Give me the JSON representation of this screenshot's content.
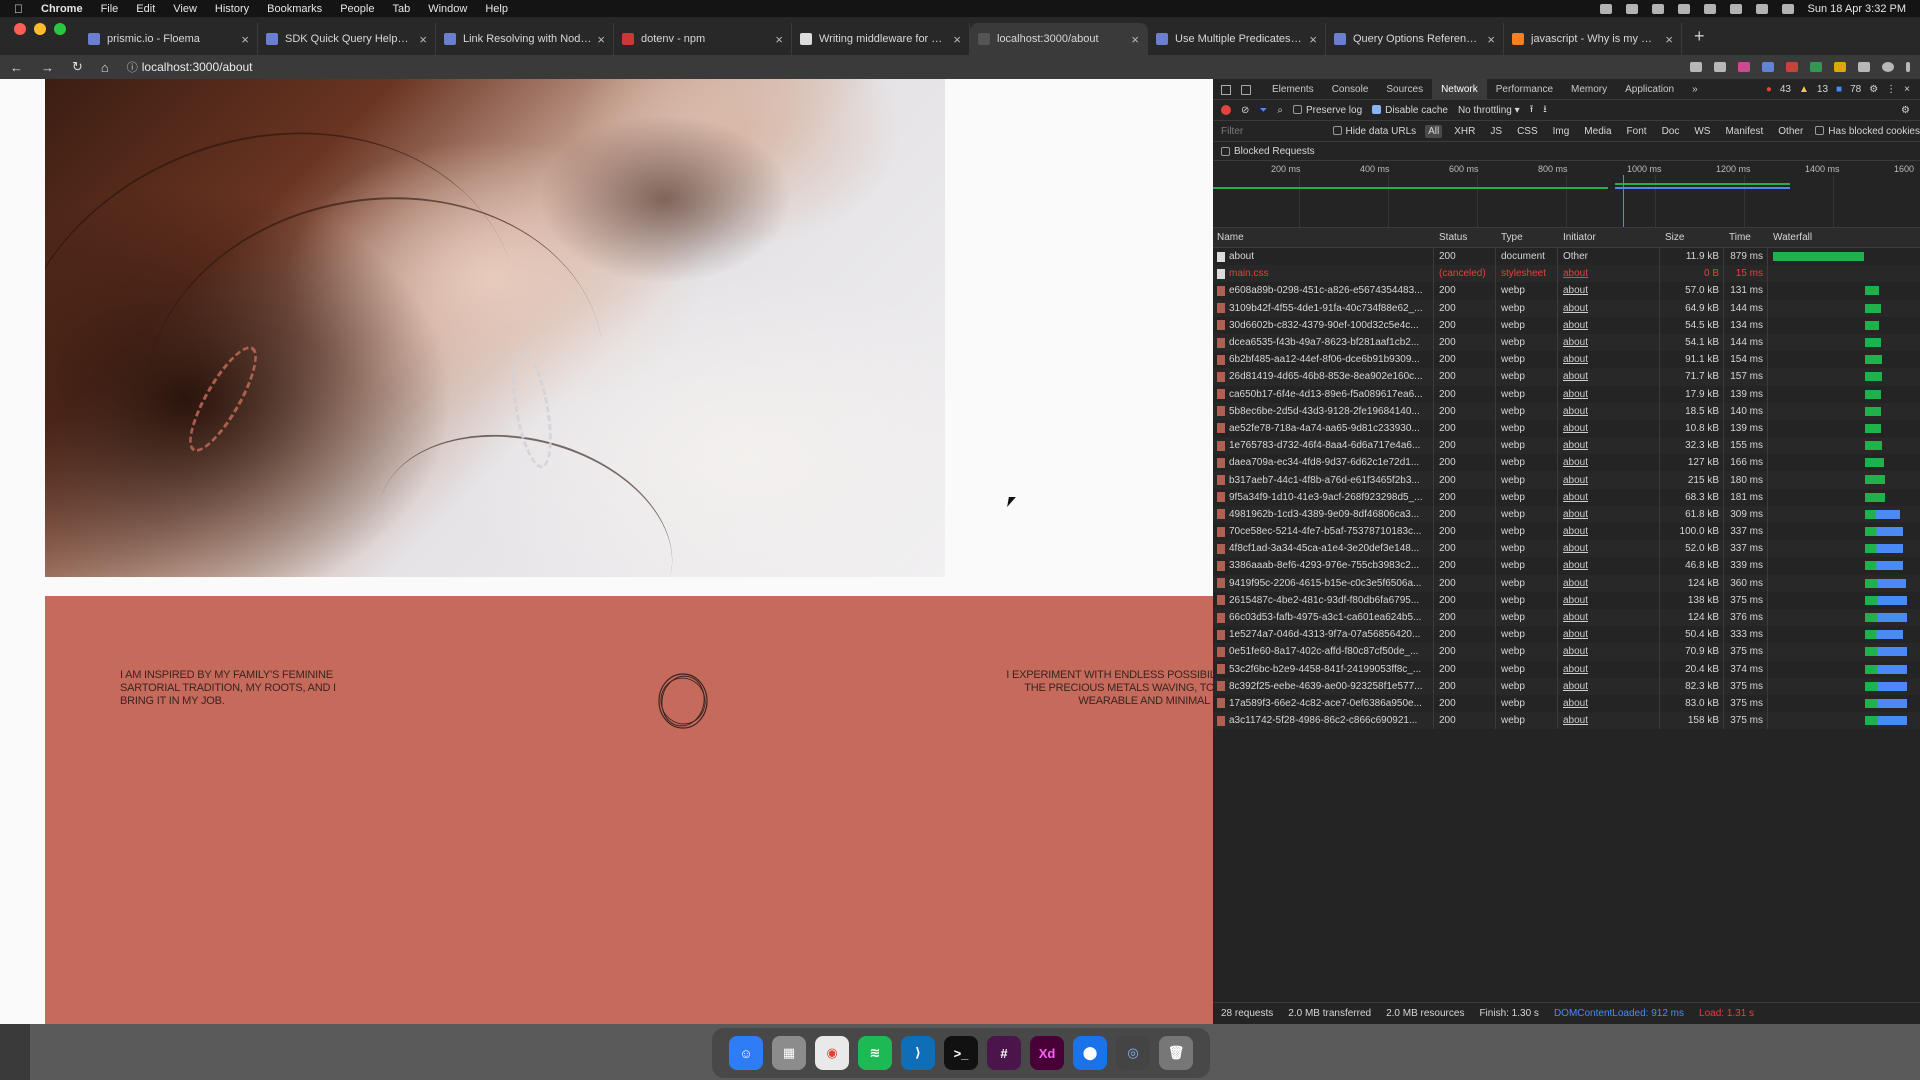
{
  "menubar": {
    "app": "Chrome",
    "items": [
      "File",
      "Edit",
      "View",
      "History",
      "Bookmarks",
      "People",
      "Tab",
      "Window",
      "Help"
    ],
    "clock": "Sun 18 Apr  3:32 PM"
  },
  "tabs": [
    {
      "title": "prismic.io - Floema"
    },
    {
      "title": "SDK Quick Query Helper functi..."
    },
    {
      "title": "Link Resolving with Node.js - P..."
    },
    {
      "title": "dotenv - npm"
    },
    {
      "title": "Writing middleware for use in E..."
    },
    {
      "title": "localhost:3000/about",
      "active": true
    },
    {
      "title": "Use Multiple Predicates in Java..."
    },
    {
      "title": "Query Options Reference in Ja..."
    },
    {
      "title": "javascript - Why is my middlew..."
    }
  ],
  "address": {
    "url": "localhost:3000/about"
  },
  "page": {
    "quote_left": "I AM INSPIRED BY MY FAMILY'S FEMININE SARTORIAL TRADITION, MY ROOTS, AND I BRING IT IN MY JOB.",
    "quote_right_1": "I EXPERIMENT WITH ENDLESS POSSIBILIT",
    "quote_right_2": "THE PRECIOUS METALS WAVING, TO C",
    "quote_right_3": "WEARABLE AND MINIMAL JE"
  },
  "devtools": {
    "panels": [
      "Elements",
      "Console",
      "Sources",
      "Network",
      "Performance",
      "Memory",
      "Application"
    ],
    "errors": "43",
    "warnings": "13",
    "messages": "78",
    "toolbar": {
      "preserve_log": "Preserve log",
      "disable_cache": "Disable cache",
      "throttling": "No throttling"
    },
    "filter": {
      "placeholder": "Filter",
      "hide_data_urls": "Hide data URLs",
      "types": [
        "All",
        "XHR",
        "JS",
        "CSS",
        "Img",
        "Media",
        "Font",
        "Doc",
        "WS",
        "Manifest",
        "Other"
      ],
      "has_blocked": "Has blocked cookies"
    },
    "blocked_requests": "Blocked Requests",
    "overview_ticks": [
      "200 ms",
      "400 ms",
      "600 ms",
      "800 ms",
      "1000 ms",
      "1200 ms",
      "1400 ms",
      "1600"
    ],
    "columns": {
      "name": "Name",
      "status": "Status",
      "type": "Type",
      "initiator": "Initiator",
      "size": "Size",
      "time": "Time",
      "waterfall": "Waterfall"
    },
    "rows": [
      {
        "name": "about",
        "status": "200",
        "type": "document",
        "initiator": "Other",
        "size": "11.9 kB",
        "time": "879 ms",
        "wf_start": 0,
        "wf_len": 0.65,
        "icon": "doc"
      },
      {
        "name": "main.css",
        "status": "(canceled)",
        "type": "stylesheet",
        "initiator": "about",
        "size": "0 B",
        "time": "15 ms",
        "wf_start": 0.66,
        "wf_len": 0,
        "icon": "doc",
        "err": true
      },
      {
        "name": "e608a89b-0298-451c-a826-e5674354483...",
        "status": "200",
        "type": "webp",
        "initiator": "about",
        "size": "57.0 kB",
        "time": "131 ms",
        "wf_start": 0.66,
        "wf_len": 0.1,
        "icon": "img"
      },
      {
        "name": "3109b42f-4f55-4de1-91fa-40c734f88e62_...",
        "status": "200",
        "type": "webp",
        "initiator": "about",
        "size": "64.9 kB",
        "time": "144 ms",
        "wf_start": 0.66,
        "wf_len": 0.11,
        "icon": "img"
      },
      {
        "name": "30d6602b-c832-4379-90ef-100d32c5e4c...",
        "status": "200",
        "type": "webp",
        "initiator": "about",
        "size": "54.5 kB",
        "time": "134 ms",
        "wf_start": 0.66,
        "wf_len": 0.1,
        "icon": "img"
      },
      {
        "name": "dcea6535-f43b-49a7-8623-bf281aaf1cb2...",
        "status": "200",
        "type": "webp",
        "initiator": "about",
        "size": "54.1 kB",
        "time": "144 ms",
        "wf_start": 0.66,
        "wf_len": 0.11,
        "icon": "img"
      },
      {
        "name": "6b2bf485-aa12-44ef-8f06-dce6b91b9309...",
        "status": "200",
        "type": "webp",
        "initiator": "about",
        "size": "91.1 kB",
        "time": "154 ms",
        "wf_start": 0.66,
        "wf_len": 0.12,
        "icon": "img"
      },
      {
        "name": "26d81419-4d65-46b8-853e-8ea902e160c...",
        "status": "200",
        "type": "webp",
        "initiator": "about",
        "size": "71.7 kB",
        "time": "157 ms",
        "wf_start": 0.66,
        "wf_len": 0.12,
        "icon": "img"
      },
      {
        "name": "ca650b17-6f4e-4d13-89e6-f5a089617ea6...",
        "status": "200",
        "type": "webp",
        "initiator": "about",
        "size": "17.9 kB",
        "time": "139 ms",
        "wf_start": 0.66,
        "wf_len": 0.11,
        "icon": "img"
      },
      {
        "name": "5b8ec6be-2d5d-43d3-9128-2fe19684140...",
        "status": "200",
        "type": "webp",
        "initiator": "about",
        "size": "18.5 kB",
        "time": "140 ms",
        "wf_start": 0.66,
        "wf_len": 0.11,
        "icon": "img"
      },
      {
        "name": "ae52fe78-718a-4a74-aa65-9d81c233930...",
        "status": "200",
        "type": "webp",
        "initiator": "about",
        "size": "10.8 kB",
        "time": "139 ms",
        "wf_start": 0.66,
        "wf_len": 0.11,
        "icon": "img"
      },
      {
        "name": "1e765783-d732-46f4-8aa4-6d6a717e4a6...",
        "status": "200",
        "type": "webp",
        "initiator": "about",
        "size": "32.3 kB",
        "time": "155 ms",
        "wf_start": 0.66,
        "wf_len": 0.12,
        "icon": "img"
      },
      {
        "name": "daea709a-ec34-4fd8-9d37-6d62c1e72d1...",
        "status": "200",
        "type": "webp",
        "initiator": "about",
        "size": "127 kB",
        "time": "166 ms",
        "wf_start": 0.66,
        "wf_len": 0.13,
        "icon": "img"
      },
      {
        "name": "b317aeb7-44c1-4f8b-a76d-e61f3465f2b3...",
        "status": "200",
        "type": "webp",
        "initiator": "about",
        "size": "215 kB",
        "time": "180 ms",
        "wf_start": 0.66,
        "wf_len": 0.14,
        "icon": "img"
      },
      {
        "name": "9f5a34f9-1d10-41e3-9acf-268f923298d5_...",
        "status": "200",
        "type": "webp",
        "initiator": "about",
        "size": "68.3 kB",
        "time": "181 ms",
        "wf_start": 0.66,
        "wf_len": 0.14,
        "icon": "img"
      },
      {
        "name": "4981962b-1cd3-4389-9e09-8df46806ca3...",
        "status": "200",
        "type": "webp",
        "initiator": "about",
        "size": "61.8 kB",
        "time": "309 ms",
        "wf_start": 0.66,
        "wf_len": 0.25,
        "icon": "img"
      },
      {
        "name": "70ce58ec-5214-4fe7-b5af-75378710183c...",
        "status": "200",
        "type": "webp",
        "initiator": "about",
        "size": "100.0 kB",
        "time": "337 ms",
        "wf_start": 0.66,
        "wf_len": 0.27,
        "icon": "img"
      },
      {
        "name": "4f8cf1ad-3a34-45ca-a1e4-3e20def3e148...",
        "status": "200",
        "type": "webp",
        "initiator": "about",
        "size": "52.0 kB",
        "time": "337 ms",
        "wf_start": 0.66,
        "wf_len": 0.27,
        "icon": "img"
      },
      {
        "name": "3386aaab-8ef6-4293-976e-755cb3983c2...",
        "status": "200",
        "type": "webp",
        "initiator": "about",
        "size": "46.8 kB",
        "time": "339 ms",
        "wf_start": 0.66,
        "wf_len": 0.27,
        "icon": "img"
      },
      {
        "name": "9419f95c-2206-4615-b15e-c0c3e5f6506a...",
        "status": "200",
        "type": "webp",
        "initiator": "about",
        "size": "124 kB",
        "time": "360 ms",
        "wf_start": 0.66,
        "wf_len": 0.29,
        "icon": "img"
      },
      {
        "name": "2615487c-4be2-481c-93df-f80db6fa6795...",
        "status": "200",
        "type": "webp",
        "initiator": "about",
        "size": "138 kB",
        "time": "375 ms",
        "wf_start": 0.66,
        "wf_len": 0.3,
        "icon": "img"
      },
      {
        "name": "66c03d53-fafb-4975-a3c1-ca601ea624b5...",
        "status": "200",
        "type": "webp",
        "initiator": "about",
        "size": "124 kB",
        "time": "376 ms",
        "wf_start": 0.66,
        "wf_len": 0.3,
        "icon": "img"
      },
      {
        "name": "1e5274a7-046d-4313-9f7a-07a56856420...",
        "status": "200",
        "type": "webp",
        "initiator": "about",
        "size": "50.4 kB",
        "time": "333 ms",
        "wf_start": 0.66,
        "wf_len": 0.27,
        "icon": "img"
      },
      {
        "name": "0e51fe60-8a17-402c-affd-f80c87cf50de_...",
        "status": "200",
        "type": "webp",
        "initiator": "about",
        "size": "70.9 kB",
        "time": "375 ms",
        "wf_start": 0.66,
        "wf_len": 0.3,
        "icon": "img"
      },
      {
        "name": "53c2f6bc-b2e9-4458-841f-24199053ff8c_...",
        "status": "200",
        "type": "webp",
        "initiator": "about",
        "size": "20.4 kB",
        "time": "374 ms",
        "wf_start": 0.66,
        "wf_len": 0.3,
        "icon": "img"
      },
      {
        "name": "8c392f25-eebe-4639-ae00-923258f1e577...",
        "status": "200",
        "type": "webp",
        "initiator": "about",
        "size": "82.3 kB",
        "time": "375 ms",
        "wf_start": 0.66,
        "wf_len": 0.3,
        "icon": "img"
      },
      {
        "name": "17a589f3-66e2-4c82-ace7-0ef6386a950e...",
        "status": "200",
        "type": "webp",
        "initiator": "about",
        "size": "83.0 kB",
        "time": "375 ms",
        "wf_start": 0.66,
        "wf_len": 0.3,
        "icon": "img"
      },
      {
        "name": "a3c11742-5f28-4986-86c2-c866c690921...",
        "status": "200",
        "type": "webp",
        "initiator": "about",
        "size": "158 kB",
        "time": "375 ms",
        "wf_start": 0.66,
        "wf_len": 0.3,
        "icon": "img"
      }
    ],
    "statusbar": {
      "requests": "28 requests",
      "transferred": "2.0 MB transferred",
      "resources": "2.0 MB resources",
      "finish": "Finish: 1.30 s",
      "dcl": "DOMContentLoaded: 912 ms",
      "load": "Load: 1.31 s"
    }
  },
  "colors": {
    "accent_red": "#e0443a",
    "dcl_blue": "#4a8af4",
    "waterfall_green": "#1fb14b",
    "band": "#c66a5c"
  }
}
